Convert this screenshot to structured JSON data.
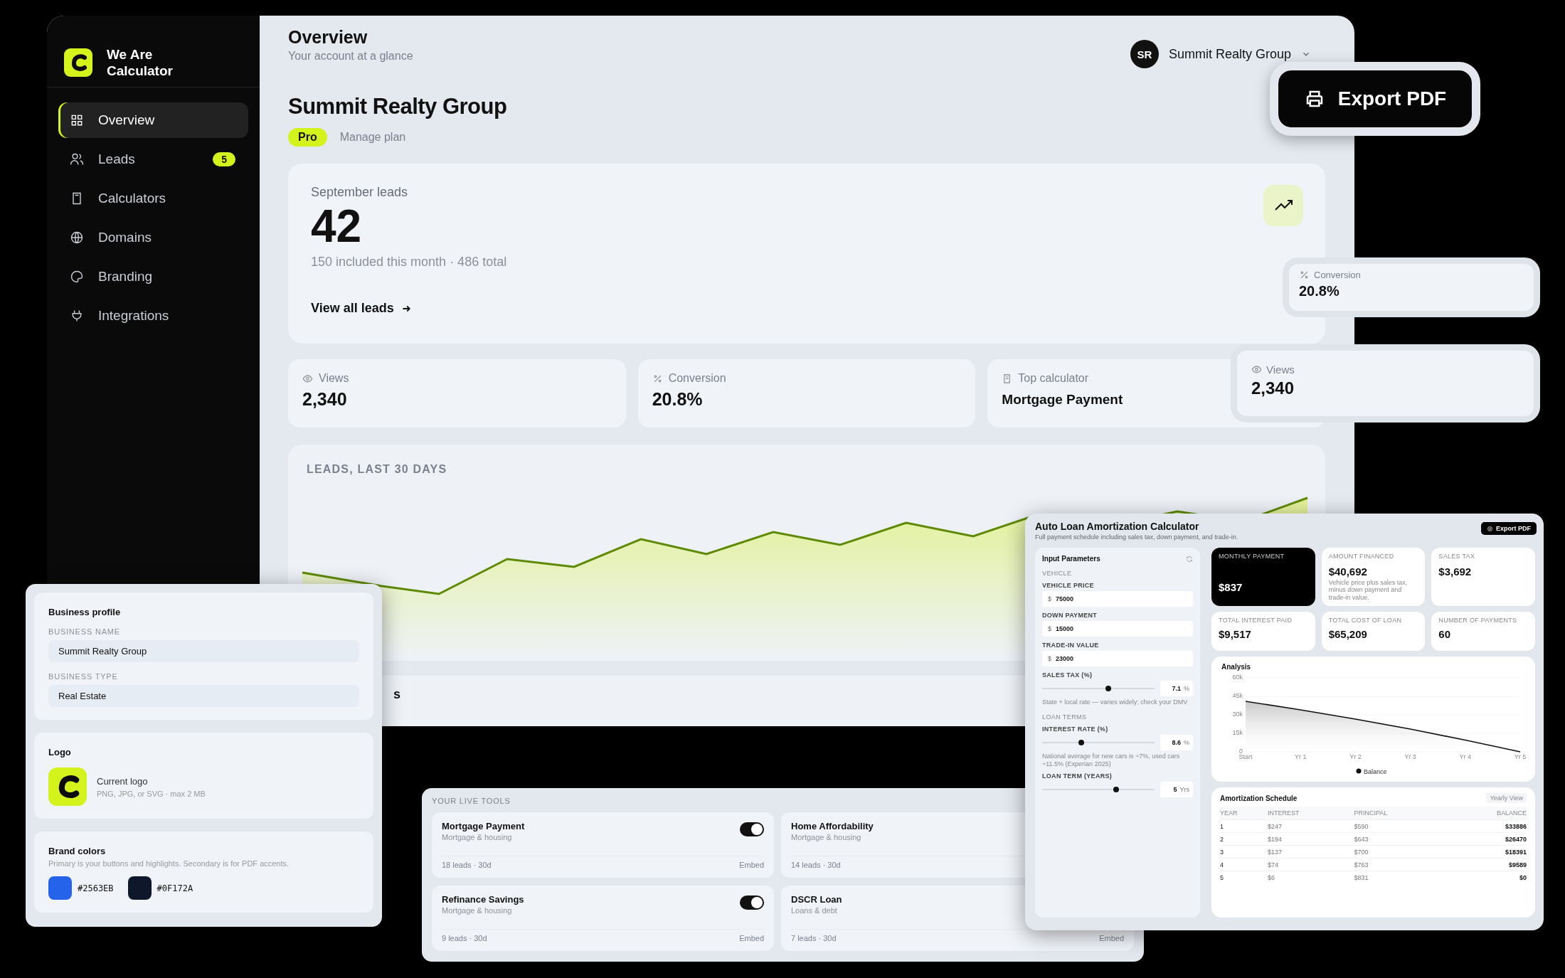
{
  "sidebar": {
    "brand": "We Are Calculator",
    "items": [
      {
        "label": "Overview",
        "selected": true
      },
      {
        "label": "Leads",
        "badge": "5",
        "selected": false
      },
      {
        "label": "Calculators",
        "selected": false
      },
      {
        "label": "Domains",
        "selected": false
      },
      {
        "label": "Branding",
        "selected": false
      },
      {
        "label": "Integrations",
        "selected": false
      }
    ]
  },
  "header": {
    "title": "Overview",
    "subtitle": "Your account at a glance",
    "user": {
      "initials": "SR",
      "name": "Summit Realty Group"
    }
  },
  "account": {
    "name": "Summit Realty Group",
    "plan": "Pro",
    "manage_link": "Manage plan"
  },
  "leads_card": {
    "label": "September leads",
    "count": "42",
    "detail": "150 included this month · 486 total",
    "link": "View all leads"
  },
  "stats": [
    {
      "kind": "number",
      "label": "Views",
      "value": "2,340"
    },
    {
      "kind": "number",
      "label": "Conversion",
      "value": "20.8%"
    },
    {
      "kind": "name",
      "label": "Top calculator",
      "value": "Mortgage Payment"
    }
  ],
  "leads_chart": {
    "title": "LEADS, LAST 30 DAYS"
  },
  "bottom_card": {
    "text": "s"
  },
  "export_button": {
    "label": "Export PDF"
  },
  "floating_stats": [
    {
      "label": "Conversion",
      "value": "20.8%"
    },
    {
      "label": "Views",
      "value": "2,340"
    }
  ],
  "settings_panel": {
    "business_profile": {
      "title": "Business profile",
      "fields": [
        {
          "label": "BUSINESS NAME",
          "value": "Summit Realty Group"
        },
        {
          "label": "BUSINESS TYPE",
          "value": "Real Estate"
        }
      ]
    },
    "logo": {
      "title": "Logo",
      "caption": "Current logo",
      "hint": "PNG, JPG, or SVG · max 2 MB"
    },
    "brand_colors": {
      "title": "Brand colors",
      "hint": "Primary is your buttons and highlights. Secondary is for PDF accents.",
      "colors": [
        {
          "color": "#2563eb",
          "code": "#2563EB"
        },
        {
          "color": "#0f172a",
          "code": "#0F172A"
        }
      ]
    }
  },
  "live_tools": {
    "title": "YOUR LIVE TOOLS",
    "tools": [
      {
        "name": "Mortgage Payment",
        "category": "Mortgage & housing",
        "stats": "18 leads · 30d",
        "on": true,
        "action": "Embed"
      },
      {
        "name": "Home Affordability",
        "category": "Mortgage & housing",
        "stats": "14 leads · 30d"
      },
      {
        "name": "Refinance Savings",
        "category": "Mortgage & housing",
        "stats": "9 leads · 30d",
        "on": true,
        "action": "Embed"
      },
      {
        "name": "DSCR Loan",
        "category": "Loans & debt",
        "stats": "7 leads · 30d",
        "action": "Embed"
      }
    ]
  },
  "calculator": {
    "title": "Auto Loan Amortization Calculator",
    "subtitle": "Full payment schedule including sales tax, down payment, and trade-in.",
    "export_label": "Export PDF",
    "inputs": {
      "title": "Input Parameters",
      "sections": [
        {
          "title": "VEHICLE",
          "fields": [
            {
              "kind": "money",
              "label": "VEHICLE PRICE",
              "prefix": "$",
              "value": "75000"
            },
            {
              "kind": "money",
              "label": "DOWN PAYMENT",
              "prefix": "$",
              "value": "15000"
            },
            {
              "kind": "money",
              "label": "TRADE-IN VALUE",
              "prefix": "$",
              "value": "23000"
            },
            {
              "kind": "slider",
              "label": "SALES TAX (%)",
              "level": 0.59,
              "value": "7.1",
              "unit": "%",
              "hint": "State + local rate — varies widely; check your DMV"
            }
          ]
        },
        {
          "title": "LOAN TERMS",
          "fields": [
            {
              "kind": "slider",
              "label": "INTEREST RATE (%)",
              "level": 0.35,
              "value": "8.6",
              "unit": "%",
              "hint": "National average for new cars is ~7%, used cars ~11.5% (Experian 2025)"
            },
            {
              "kind": "slider",
              "label": "LOAN TERM (YEARS)",
              "level": 0.66,
              "value": "5",
              "unit": "Yrs"
            }
          ]
        }
      ]
    },
    "metrics": [
      {
        "kind": "highlight",
        "label": "MONTHLY PAYMENT",
        "value": "$837"
      },
      {
        "kind": "plain",
        "label": "AMOUNT FINANCED",
        "value": "$40,692",
        "note": "Vehicle price plus sales tax, minus down payment and trade-in value."
      },
      {
        "kind": "plain",
        "label": "SALES TAX",
        "value": "$3,692"
      },
      {
        "kind": "plain",
        "label": "TOTAL INTEREST PAID",
        "value": "$9,517"
      },
      {
        "kind": "plain",
        "label": "TOTAL COST OF LOAN",
        "value": "$65,209"
      },
      {
        "kind": "plain",
        "label": "NUMBER OF PAYMENTS",
        "value": "60"
      }
    ],
    "analysis": {
      "title": "Analysis",
      "chart_data": {
        "type": "area",
        "x": [
          "Start",
          "Yr 1",
          "Yr 2",
          "Yr 3",
          "Yr 4",
          "Yr 5"
        ],
        "series": [
          {
            "name": "Balance",
            "color": "#111111",
            "values": [
              41000,
              34000,
              26500,
              18500,
              9500,
              0
            ]
          }
        ],
        "ylim": [
          0,
          60000
        ],
        "yticks": [
          {
            "value": 0,
            "label": "0"
          },
          {
            "value": 15000,
            "label": "15k"
          },
          {
            "value": 30000,
            "label": "30k"
          },
          {
            "value": 45000,
            "label": "45k"
          },
          {
            "value": 60000,
            "label": "60k"
          }
        ]
      }
    },
    "schedule": {
      "title": "Amortization Schedule",
      "view_button": "Yearly View",
      "columns": [
        "YEAR",
        "INTEREST",
        "PRINCIPAL",
        "BALANCE"
      ],
      "rows": [
        [
          "1",
          "$247",
          "$590",
          "$33886"
        ],
        [
          "2",
          "$194",
          "$643",
          "$26470"
        ],
        [
          "3",
          "$137",
          "$700",
          "$18391"
        ],
        [
          "4",
          "$74",
          "$763",
          "$9589"
        ],
        [
          "5",
          "$6",
          "$831",
          "$0"
        ]
      ]
    }
  }
}
